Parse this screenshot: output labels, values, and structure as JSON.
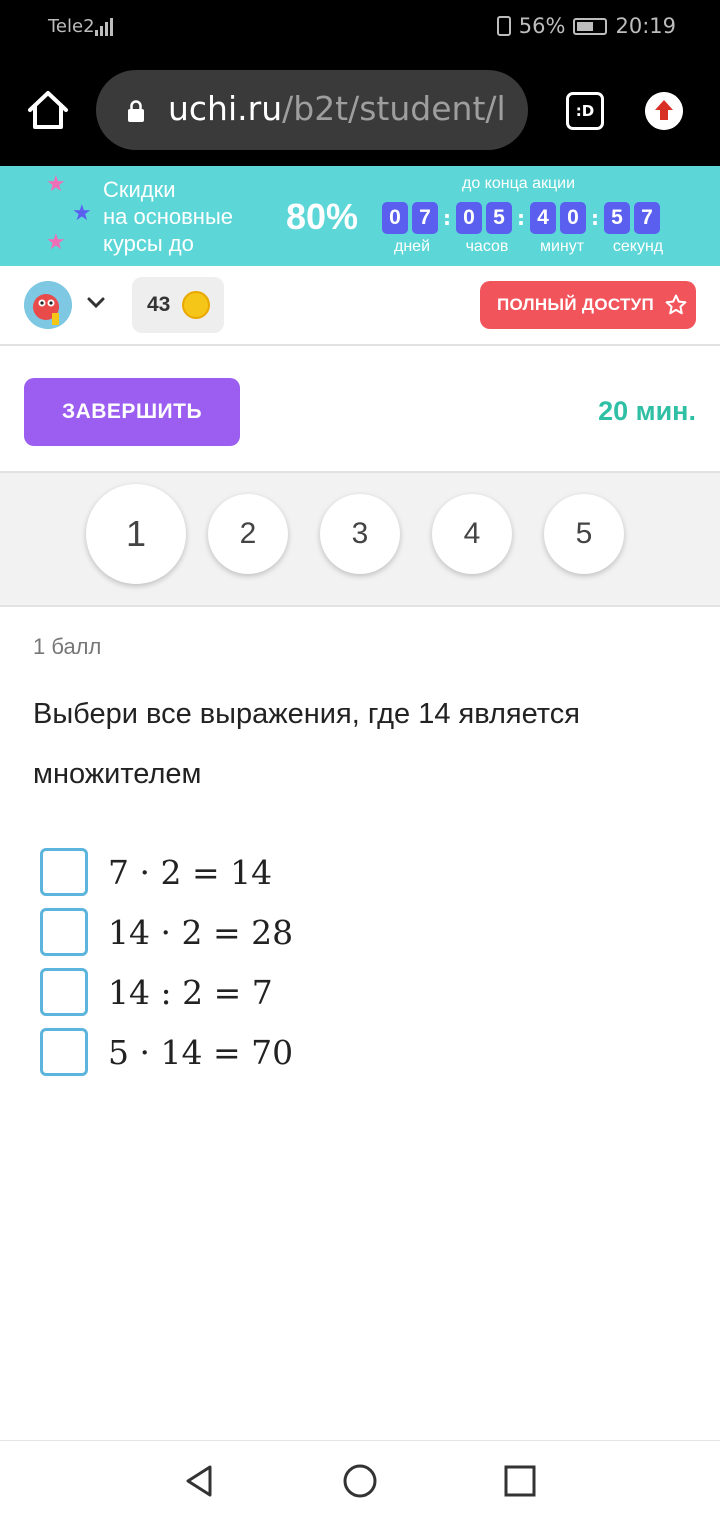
{
  "status_bar": {
    "carrier": "Tele2",
    "battery": "56%",
    "time": "20:19"
  },
  "browser": {
    "url_host": "uchi.ru",
    "url_path": "/b2t/student/l",
    "tab_badge": ":D"
  },
  "promo": {
    "line1": "Скидки",
    "line2": "на основные",
    "line3": "курсы до",
    "percent": "80%",
    "until_label": "до конца акции",
    "days": [
      "0",
      "7"
    ],
    "hours": [
      "0",
      "5"
    ],
    "minutes": [
      "4",
      "0"
    ],
    "seconds": [
      "5",
      "7"
    ],
    "days_label": "дней",
    "hours_label": "часов",
    "minutes_label": "минут",
    "seconds_label": "секунд"
  },
  "header": {
    "coins": "43",
    "full_access_label": "ПОЛНЫЙ ДОСТУП"
  },
  "actions": {
    "finish_label": "ЗАВЕРШИТЬ",
    "time_left": "20 мин."
  },
  "question_nav": [
    "1",
    "2",
    "3",
    "4",
    "5"
  ],
  "question": {
    "points": "1 балл",
    "line1": "Выбери все выражения, где 14 является",
    "line2": "множителем",
    "options": [
      "7 · 2 = 14",
      "14 · 2 = 28",
      "14 : 2 = 7",
      "5 · 14 = 70"
    ]
  },
  "colors": {
    "promo_bg": "#5dd6d7",
    "timer_digit": "#5a5ff0",
    "finish_button": "#9b5ef0",
    "full_access": "#f2545b",
    "time_green": "#2ebfa5",
    "checkbox_border": "#5db4dc"
  },
  "icons": {
    "home": "home-icon",
    "lock": "lock-icon",
    "update": "update-arrow-icon",
    "coin": "coin-icon",
    "star": "star-icon",
    "chevron": "chevron-down-icon"
  }
}
